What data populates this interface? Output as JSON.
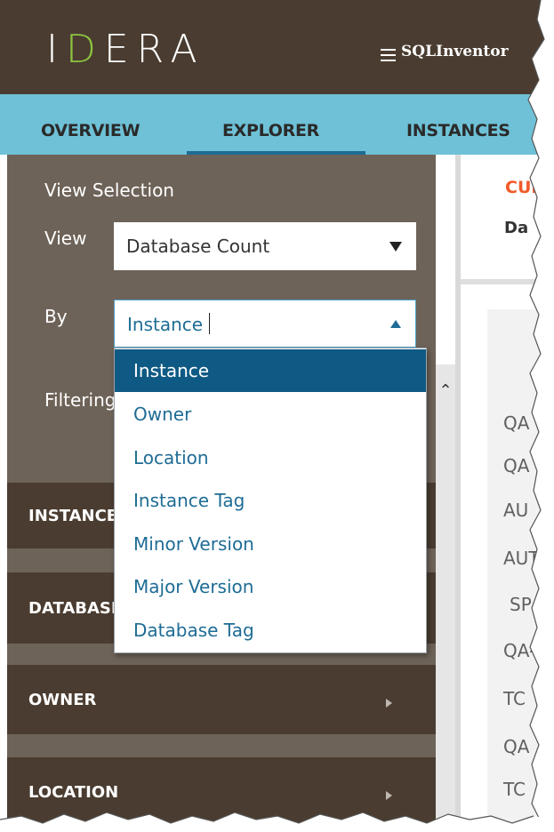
{
  "header": {
    "logo": {
      "left": "I",
      "mid": "D",
      "right": "ERA"
    },
    "menu_icon": "hamburger-menu-icon",
    "app_title": "SQLInventor"
  },
  "tabs": [
    {
      "label": "OVERVIEW",
      "active": false
    },
    {
      "label": "EXPLORER",
      "active": true
    },
    {
      "label": "INSTANCES",
      "active": false
    }
  ],
  "view_selection": {
    "title": "View Selection",
    "view_label": "View",
    "view_value": "Database Count",
    "by_label": "By",
    "by_value": "Instance",
    "filtering_label": "Filtering"
  },
  "by_options": [
    {
      "label": "Instance",
      "selected": true
    },
    {
      "label": "Owner",
      "selected": false
    },
    {
      "label": "Location",
      "selected": false
    },
    {
      "label": "Instance Tag",
      "selected": false
    },
    {
      "label": "Minor Version",
      "selected": false
    },
    {
      "label": "Major Version",
      "selected": false
    },
    {
      "label": "Database Tag",
      "selected": false
    }
  ],
  "sections": [
    {
      "label": "INSTANCES"
    },
    {
      "label": "DATABASES"
    },
    {
      "label": "OWNER"
    },
    {
      "label": "LOCATION"
    }
  ],
  "content": {
    "current_label": "CUR",
    "subheader": "Da",
    "rows": [
      "QA",
      "QA",
      "AU",
      "AUT",
      "SP",
      "QA-",
      "TC",
      "QA",
      "TC"
    ]
  },
  "colors": {
    "topbar": "#4a3c30",
    "tabbar": "#6ec1d6",
    "active_tab_underline": "#1e6c95",
    "left_panel": "#6e6358",
    "section_bar": "#4a3c30",
    "dropdown_selected": "#0f5a84",
    "dropdown_text": "#1e6c95",
    "logo_accent": "#8dc63f",
    "current_label": "#f05a28"
  }
}
